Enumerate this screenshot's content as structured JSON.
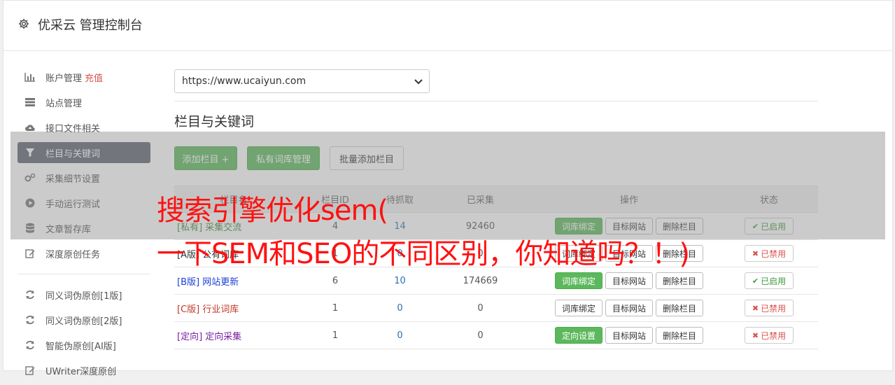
{
  "header": {
    "title": "优采云 管理控制台",
    "icon": "gear-icon"
  },
  "sidebar": {
    "items": [
      {
        "label": "账户管理",
        "extra": "充值",
        "icon": "bar-chart-icon"
      },
      {
        "label": "站点管理",
        "icon": "server-icon"
      },
      {
        "label": "接口文件相关",
        "icon": "cloud-upload-icon"
      },
      {
        "label": "栏目与关键词",
        "icon": "filter-icon",
        "active": true
      },
      {
        "label": "采集细节设置",
        "icon": "cogs-icon"
      },
      {
        "label": "手动运行测试",
        "icon": "play-circle-icon"
      },
      {
        "label": "文章暂存库",
        "icon": "database-icon"
      },
      {
        "label": "深度原创任务",
        "icon": "edit-icon"
      }
    ],
    "items2": [
      {
        "label": "同义词伪原创[1版]",
        "icon": "refresh-icon"
      },
      {
        "label": "同义词伪原创[2版]",
        "icon": "refresh-icon"
      },
      {
        "label": "智能伪原创[AI版]",
        "icon": "refresh-icon"
      },
      {
        "label": "UWriter深度原创",
        "icon": "edit-icon"
      }
    ]
  },
  "main": {
    "site_select": {
      "value": "https://www.ucaiyun.com"
    },
    "section_title": "栏目与关键词",
    "buttons": {
      "add_column": "添加栏目 +",
      "private_lib": "私有词库管理",
      "batch_add": "批量添加栏目"
    },
    "table": {
      "headers": [
        "栏目名",
        "栏目ID",
        "待抓取",
        "已采集",
        "操作",
        "状态"
      ],
      "rows": [
        {
          "name": "[私有] 采集交流",
          "id": "4",
          "pending": "14",
          "collected": "92460",
          "op1": "词库绑定",
          "op2": "目标网站",
          "op3": "删除栏目",
          "status": "已启用",
          "state": "on",
          "op1_green": true
        },
        {
          "name": "[A版] 公有词库",
          "id": "1",
          "pending": "0",
          "collected": "0",
          "op1": "词库绑定",
          "op2": "目标网站",
          "op3": "删除栏目",
          "status": "已禁用",
          "state": "off",
          "op1_green": false
        },
        {
          "name": "[B版] 网站更新",
          "id": "6",
          "pending": "10",
          "collected": "174669",
          "op1": "词库绑定",
          "op2": "目标网站",
          "op3": "删除栏目",
          "status": "已启用",
          "state": "on",
          "op1_green": true
        },
        {
          "name": "[C版] 行业词库",
          "id": "1",
          "pending": "0",
          "collected": "0",
          "op1": "词库绑定",
          "op2": "目标网站",
          "op3": "删除栏目",
          "status": "已禁用",
          "state": "off",
          "op1_green": false
        },
        {
          "name": "[定向] 定向采集",
          "id": "1",
          "pending": "0",
          "collected": "0",
          "op1": "定向设置",
          "op2": "目标网站",
          "op3": "删除栏目",
          "status": "已禁用",
          "state": "off",
          "op1_green": true
        }
      ]
    }
  },
  "overlay": {
    "line1": "搜索引擎优化sem(",
    "line2": "一下SEM和SEO的不同区别，你知道吗？！)"
  },
  "colors": {
    "green": "#5cb85c",
    "active_sidebar": "#5e6570",
    "overlay_text": "#ff1111",
    "danger": "#d9534f"
  }
}
